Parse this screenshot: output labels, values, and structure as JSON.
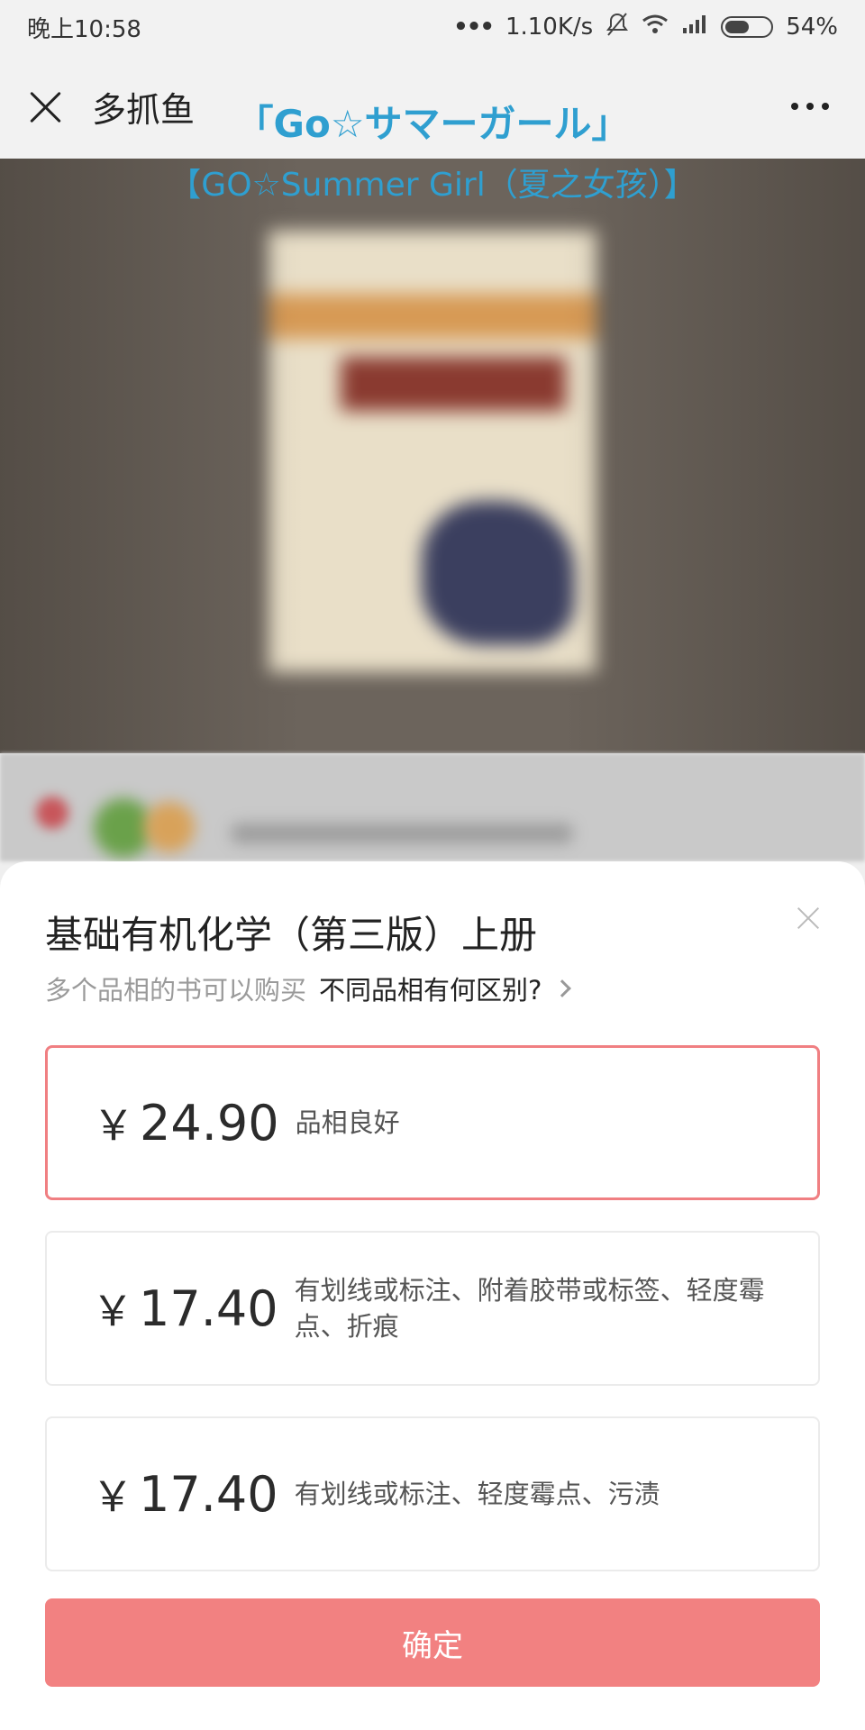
{
  "status_bar": {
    "time": "晚上10:58",
    "network_speed": "1.10K/s",
    "battery": "54%",
    "battery_level": 0.54
  },
  "nav": {
    "title": "多抓鱼"
  },
  "overlay": {
    "line1": "「Go☆サマーガール」",
    "line2": "【GO☆Summer Girl（夏之女孩）】"
  },
  "sheet": {
    "book_title": "基础有机化学（第三版）上册",
    "hint": "多个品相的书可以购买",
    "hint_link": "不同品相有何区别?",
    "options": [
      {
        "currency": "￥",
        "price": "24.90",
        "condition": "品相良好",
        "selected": true
      },
      {
        "currency": "￥",
        "price": "17.40",
        "condition": "有划线或标注、附着胶带或标签、轻度霉点、折痕",
        "selected": false
      },
      {
        "currency": "￥",
        "price": "17.40",
        "condition": "有划线或标注、轻度霉点、污渍",
        "selected": false
      }
    ],
    "confirm_label": "确定"
  },
  "colors": {
    "accent": "#f28181",
    "selected_border": "#f07f82",
    "overlay_text": "#2f9fd0"
  }
}
